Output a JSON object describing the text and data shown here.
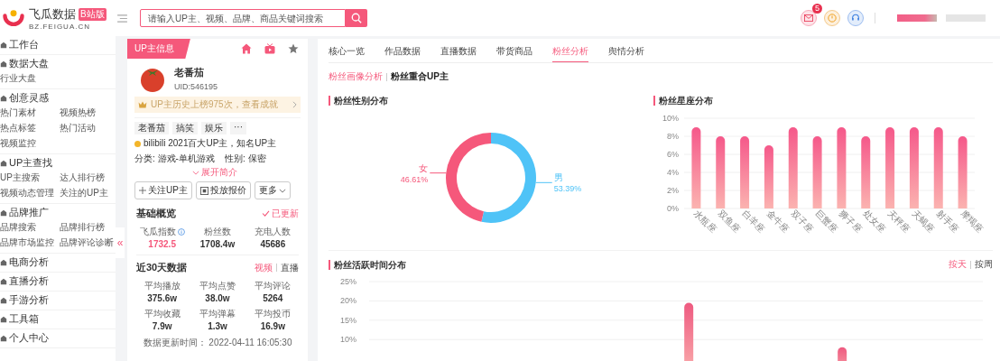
{
  "header": {
    "logo_title": "飞瓜数据",
    "logo_badge": "B站版",
    "logo_domain": "BZ.FEIGUA.CN",
    "search": {
      "placeholder": "请输入UP主、视频、品牌、商品关键词搜索"
    },
    "mail_badge": "5"
  },
  "sidebar": {
    "collapse_glyph": "«",
    "sections": [
      {
        "label": "工作台"
      },
      {
        "label": "数据大盘",
        "items": [
          "行业大盘"
        ]
      },
      {
        "label": "创意灵感",
        "items": [
          "热门素材",
          "视频热榜",
          "热点标签",
          "热门活动",
          "视频监控"
        ]
      },
      {
        "label": "UP主查找",
        "items": [
          "UP主搜索",
          "达人排行榜",
          "视频动态管理",
          "关注的UP主"
        ]
      },
      {
        "label": "品牌推广",
        "items": [
          "品牌搜索",
          "品牌排行榜",
          "品牌市场监控",
          "品牌评论诊断"
        ]
      },
      {
        "label": "电商分析"
      },
      {
        "label": "直播分析"
      },
      {
        "label": "手游分析"
      },
      {
        "label": "工具箱"
      },
      {
        "label": "个人中心"
      }
    ]
  },
  "up_panel": {
    "tab": "UP主信息",
    "name": "老番茄",
    "uid": "UID:546195",
    "achievement": "UP主历史上榜975次，查看成就",
    "tags": [
      "老番茄",
      "搞笑",
      "娱乐",
      "···"
    ],
    "honor": "bilibili 2021百大UP主，知名UP主",
    "category": "分类: 游戏-单机游戏",
    "gender": "性别: 保密",
    "expand": "展开简介",
    "buttons": [
      {
        "kind": "plus",
        "label": "关注UP主"
      },
      {
        "kind": "quote",
        "label": "投放报价"
      },
      {
        "kind": "more",
        "label": "更多"
      }
    ],
    "basic": {
      "title": "基础概览",
      "status": "已更新",
      "stats": [
        {
          "label": "飞瓜指数",
          "value": "1732.5",
          "highlight": true
        },
        {
          "label": "粉丝数",
          "value": "1708.4w",
          "highlight": false
        },
        {
          "label": "充电人数",
          "value": "45686",
          "highlight": false
        }
      ]
    },
    "recent": {
      "title": "近30天数据",
      "options": [
        {
          "label": "视频",
          "selected": true
        },
        {
          "label": "直播",
          "selected": false
        }
      ],
      "stats": [
        {
          "label": "平均播放",
          "value": "375.6w"
        },
        {
          "label": "平均点赞",
          "value": "38.0w"
        },
        {
          "label": "平均评论",
          "value": "5264"
        },
        {
          "label": "平均收藏",
          "value": "7.9w"
        },
        {
          "label": "平均弹幕",
          "value": "1.3w"
        },
        {
          "label": "平均投币",
          "value": "16.9w"
        }
      ]
    },
    "updated": "数据更新时间：  2022-04-11 16:05:30"
  },
  "main": {
    "tabs": [
      {
        "label": "核心一览",
        "selected": false
      },
      {
        "label": "作品数据",
        "selected": false
      },
      {
        "label": "直播数据",
        "selected": false
      },
      {
        "label": "带货商品",
        "selected": false
      },
      {
        "label": "粉丝分析",
        "selected": true
      },
      {
        "label": "舆情分析",
        "selected": false
      }
    ],
    "subtabs": [
      {
        "label": "粉丝画像分析",
        "selected": true
      },
      {
        "label": "粉丝重合UP主",
        "selected": false
      }
    ],
    "gender": {
      "title": "粉丝性别分布",
      "chart_data": {
        "type": "donut",
        "categories": [
          "男",
          "女"
        ],
        "values": [
          53.39,
          46.61
        ],
        "data_labels": true,
        "colors": [
          "#4fc3f7",
          "#f5587b"
        ],
        "value_labels": [
          "53.39%",
          "46.61%"
        ]
      }
    },
    "zodiac": {
      "title": "粉丝星座分布",
      "chart_data": {
        "type": "bar",
        "grid": true,
        "categories": [
          "水瓶座",
          "双鱼座",
          "白羊座",
          "金牛座",
          "双子座",
          "巨蟹座",
          "狮子座",
          "处女座",
          "天秤座",
          "天蝎座",
          "射手座",
          "摩羯座"
        ],
        "values": [
          9,
          8,
          8,
          7,
          9,
          8,
          9,
          8,
          9,
          9,
          9,
          8
        ],
        "ylim": [
          0,
          10
        ],
        "yticks": [
          {
            "value": 0,
            "label": "0%"
          },
          {
            "value": 2,
            "label": "2%"
          },
          {
            "value": 4,
            "label": "4%"
          },
          {
            "value": 6,
            "label": "6%"
          },
          {
            "value": 8,
            "label": "8%"
          },
          {
            "value": 10,
            "label": "10%"
          }
        ]
      }
    },
    "activity": {
      "title": "粉丝活跃时间分布",
      "options": [
        {
          "label": "按天",
          "selected": true
        },
        {
          "label": "按周",
          "selected": false
        }
      ],
      "chart_data": {
        "type": "bar",
        "grid": true,
        "values": [
          null,
          null,
          null,
          null,
          null,
          null,
          null,
          null,
          null,
          null,
          null,
          null,
          19.5,
          null,
          null,
          null,
          null,
          null,
          8,
          null,
          null,
          null,
          null,
          null
        ],
        "ylim": [
          0,
          25
        ],
        "yticks": [
          {
            "value": 10,
            "label": "10%"
          },
          {
            "value": 15,
            "label": "15%"
          },
          {
            "value": 20,
            "label": "20%"
          },
          {
            "value": 25,
            "label": "25%"
          }
        ]
      }
    }
  }
}
